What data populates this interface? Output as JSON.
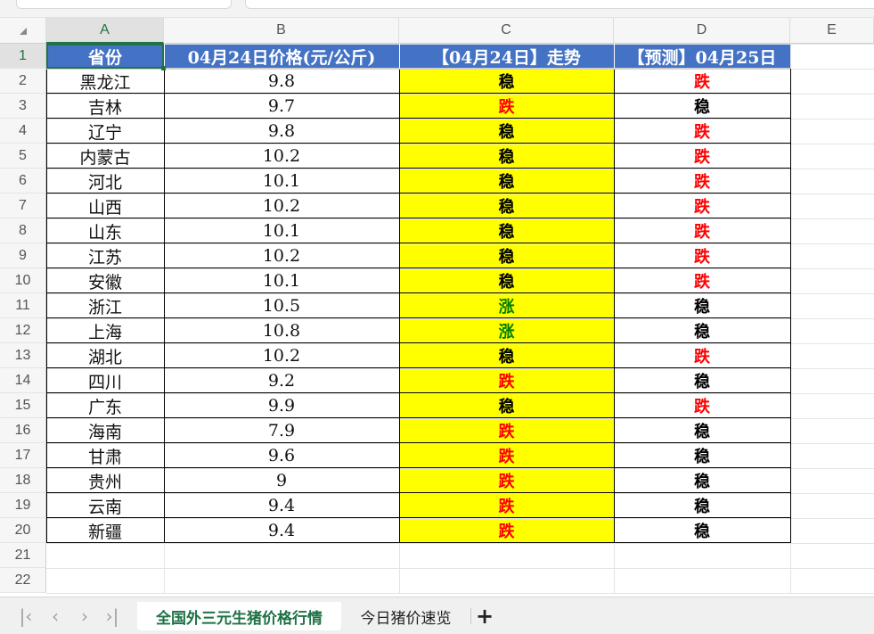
{
  "columns": [
    "A",
    "B",
    "C",
    "D",
    "E"
  ],
  "header": {
    "province": "省份",
    "price": "04月24日价格(元/公斤)",
    "trend": "【04月24日】走势",
    "forecast": "【预测】04月25日"
  },
  "rows": [
    {
      "province": "黑龙江",
      "price": "9.8",
      "trend": "稳",
      "forecast": "跌"
    },
    {
      "province": "吉林",
      "price": "9.7",
      "trend": "跌",
      "forecast": "稳"
    },
    {
      "province": "辽宁",
      "price": "9.8",
      "trend": "稳",
      "forecast": "跌"
    },
    {
      "province": "内蒙古",
      "price": "10.2",
      "trend": "稳",
      "forecast": "跌"
    },
    {
      "province": "河北",
      "price": "10.1",
      "trend": "稳",
      "forecast": "跌"
    },
    {
      "province": "山西",
      "price": "10.2",
      "trend": "稳",
      "forecast": "跌"
    },
    {
      "province": "山东",
      "price": "10.1",
      "trend": "稳",
      "forecast": "跌"
    },
    {
      "province": "江苏",
      "price": "10.2",
      "trend": "稳",
      "forecast": "跌"
    },
    {
      "province": "安徽",
      "price": "10.1",
      "trend": "稳",
      "forecast": "跌"
    },
    {
      "province": "浙江",
      "price": "10.5",
      "trend": "涨",
      "forecast": "稳"
    },
    {
      "province": "上海",
      "price": "10.8",
      "trend": "涨",
      "forecast": "稳"
    },
    {
      "province": "湖北",
      "price": "10.2",
      "trend": "稳",
      "forecast": "跌"
    },
    {
      "province": "四川",
      "price": "9.2",
      "trend": "跌",
      "forecast": "稳"
    },
    {
      "province": "广东",
      "price": "9.9",
      "trend": "稳",
      "forecast": "跌"
    },
    {
      "province": "海南",
      "price": "7.9",
      "trend": "跌",
      "forecast": "稳"
    },
    {
      "province": "甘肃",
      "price": "9.6",
      "trend": "跌",
      "forecast": "稳"
    },
    {
      "province": "贵州",
      "price": "9",
      "trend": "跌",
      "forecast": "稳"
    },
    {
      "province": "云南",
      "price": "9.4",
      "trend": "跌",
      "forecast": "稳"
    },
    {
      "province": "新疆",
      "price": "9.4",
      "trend": "跌",
      "forecast": "稳"
    }
  ],
  "trend_colors": {
    "稳": "#000000",
    "跌": "#ff0000",
    "涨": "#008000"
  },
  "colors": {
    "header_bg": "#4472c4",
    "trend_bg": "#ffff00",
    "tab_active": "#1e7145"
  },
  "sheet_tabs": [
    {
      "label": "全国外三元生猪价格行情",
      "active": true
    },
    {
      "label": "今日猪价速览",
      "active": false
    }
  ],
  "tab_nav_icons": [
    "first-sheet-icon",
    "prev-sheet-icon",
    "next-sheet-icon",
    "last-sheet-icon",
    "add-sheet-icon"
  ]
}
